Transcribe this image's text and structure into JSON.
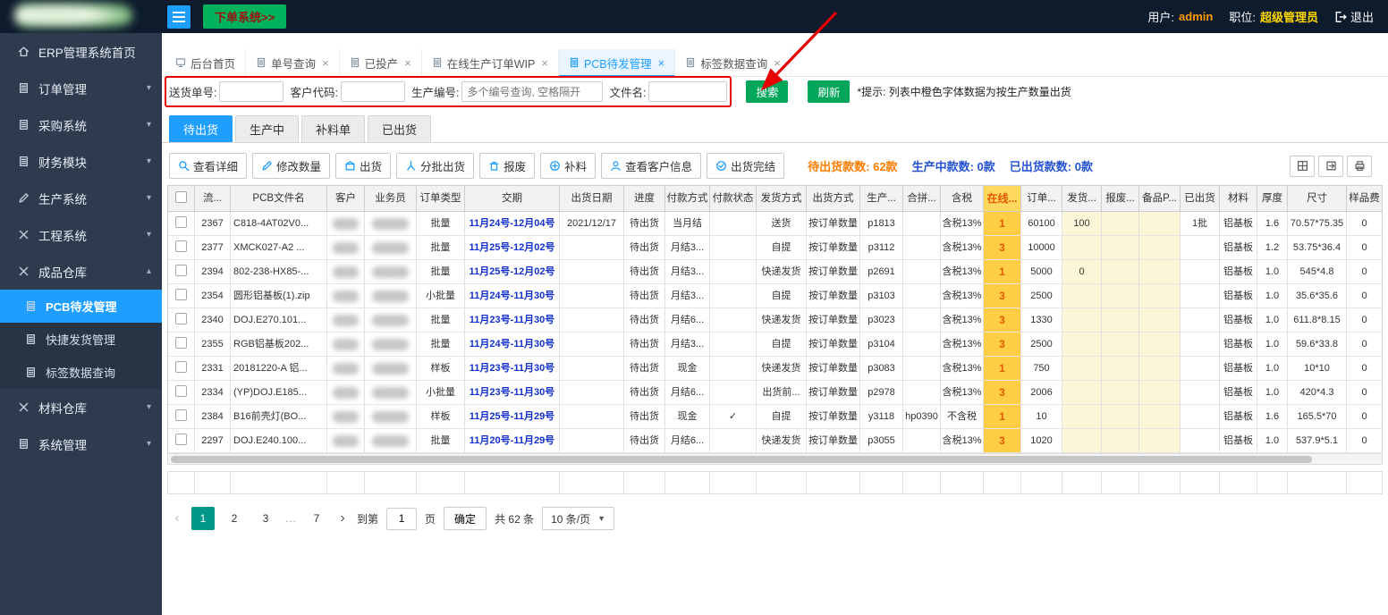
{
  "colors": {
    "accent_blue": "#1e9fff",
    "button_green": "#00a65a",
    "topbar_green": "#00b15c",
    "amber_cell": "#ffce45",
    "pale_yellow": "#fcf6d9",
    "annotation_red": "#e60000",
    "page_active_green": "#009688",
    "date_blue": "#1330cc"
  },
  "topbar": {
    "order_system_button": "下单系统>>",
    "user_label": "用户:",
    "user_value": "admin",
    "role_label": "职位:",
    "role_value": "超级管理员",
    "logout": "退出"
  },
  "sidebar": {
    "items": [
      {
        "label": "ERP管理系统首页",
        "icon": "home",
        "level": 1
      },
      {
        "label": "订单管理",
        "icon": "doc",
        "level": 1,
        "arrow": "down"
      },
      {
        "label": "采购系统",
        "icon": "doc",
        "level": 1,
        "arrow": "down"
      },
      {
        "label": "财务模块",
        "icon": "doc",
        "level": 1,
        "arrow": "down"
      },
      {
        "label": "生产系统",
        "icon": "pencil",
        "level": 1,
        "arrow": "down"
      },
      {
        "label": "工程系统",
        "icon": "tools",
        "level": 1,
        "arrow": "down"
      },
      {
        "label": "成品仓库",
        "icon": "tools",
        "level": 1,
        "arrow": "up"
      },
      {
        "label": "PCB待发管理",
        "icon": "doc",
        "level": 2,
        "active": true
      },
      {
        "label": "快捷发货管理",
        "icon": "doc",
        "level": 2
      },
      {
        "label": "标签数据查询",
        "icon": "doc",
        "level": 2
      },
      {
        "label": "材料仓库",
        "icon": "tools",
        "level": 1,
        "arrow": "down"
      },
      {
        "label": "系统管理",
        "icon": "doc",
        "level": 1,
        "arrow": "down"
      }
    ]
  },
  "tabs": [
    {
      "label": "后台首页",
      "icon": "monitor",
      "closable": false
    },
    {
      "label": "单号查询",
      "icon": "doc",
      "closable": true
    },
    {
      "label": "已投产",
      "icon": "doc",
      "closable": true
    },
    {
      "label": "在线生产订单WIP",
      "icon": "doc",
      "closable": true
    },
    {
      "label": "PCB待发管理",
      "icon": "doc",
      "closable": true,
      "active": true
    },
    {
      "label": "标签数据查询",
      "icon": "doc",
      "closable": true
    }
  ],
  "search": {
    "fields": [
      {
        "label": "送货单号:",
        "placeholder": ""
      },
      {
        "label": "客户代码:",
        "placeholder": ""
      },
      {
        "label": "生产编号:",
        "placeholder": "多个编号查询, 空格隔开"
      },
      {
        "label": "文件名:",
        "placeholder": ""
      }
    ],
    "search_button": "搜索",
    "refresh_button": "刷新",
    "hint": "*提示: 列表中橙色字体数据为按生产数量出货"
  },
  "subtabs": [
    {
      "label": "待出货",
      "active": true
    },
    {
      "label": "生产中"
    },
    {
      "label": "补料单"
    },
    {
      "label": "已出货"
    }
  ],
  "toolbar": {
    "buttons": [
      {
        "label": "查看详细",
        "icon": "magnifier"
      },
      {
        "label": "修改数量",
        "icon": "pencil"
      },
      {
        "label": "出货",
        "icon": "box"
      },
      {
        "label": "分批出货",
        "icon": "split"
      },
      {
        "label": "报废",
        "icon": "trash"
      },
      {
        "label": "补料",
        "icon": "plus"
      },
      {
        "label": "查看客户信息",
        "icon": "person"
      },
      {
        "label": "出货完结",
        "icon": "check"
      }
    ],
    "stats": [
      {
        "label": "待出货款数:",
        "value": "62款",
        "color": "orange"
      },
      {
        "label": "生产中款数:",
        "value": "0款",
        "color": "blue"
      },
      {
        "label": "已出货款数:",
        "value": "0款",
        "color": "blue"
      }
    ],
    "right_icons": [
      {
        "name": "columns",
        "icon": "grid"
      },
      {
        "name": "export",
        "icon": "export"
      },
      {
        "name": "print",
        "icon": "printer"
      }
    ]
  },
  "table": {
    "columns": [
      "流...",
      "PCB文件名",
      "客户",
      "业务员",
      "订单类型",
      "交期",
      "出货日期",
      "进度",
      "付款方式",
      "付款状态",
      "发货方式",
      "出货方式",
      "生产...",
      "合拼...",
      "含税",
      "在线...",
      "订单...",
      "发货...",
      "报废...",
      "备品P...",
      "已出货",
      "材料",
      "厚度",
      "尺寸",
      "样品费"
    ],
    "rows": [
      [
        "2367",
        "C818-4AT02V0...",
        "",
        "",
        "批量",
        "11月24号-12月04号",
        "2021/12/17",
        "待出货",
        "当月结",
        "",
        "送货",
        "按订单数量",
        "p1813",
        "",
        "含税13%",
        "1",
        "60100",
        "100",
        "",
        "",
        "1批",
        "铝基板",
        "1.6",
        "70.57*75.35",
        "0"
      ],
      [
        "2377",
        "XMCK027-A2 ...",
        "",
        "",
        "批量",
        "11月25号-12月02号",
        "",
        "待出货",
        "月结3...",
        "",
        "自提",
        "按订单数量",
        "p3112",
        "",
        "含税13%",
        "3",
        "10000",
        "",
        "",
        "",
        "",
        "铝基板",
        "1.2",
        "53.75*36.4",
        "0"
      ],
      [
        "2394",
        "802-238-HX85-...",
        "",
        "",
        "批量",
        "11月25号-12月02号",
        "",
        "待出货",
        "月结3...",
        "",
        "快递发货",
        "按订单数量",
        "p2691",
        "",
        "含税13%",
        "1",
        "5000",
        "0",
        "",
        "",
        "",
        "铝基板",
        "1.0",
        "545*4.8",
        "0"
      ],
      [
        "2354",
        "圆形铝基板(1).zip",
        "",
        "",
        "小批量",
        "11月24号-11月30号",
        "",
        "待出货",
        "月结3...",
        "",
        "自提",
        "按订单数量",
        "p3103",
        "",
        "含税13%",
        "3",
        "2500",
        "",
        "",
        "",
        "",
        "铝基板",
        "1.0",
        "35.6*35.6",
        "0"
      ],
      [
        "2340",
        "DOJ.E270.101...",
        "",
        "",
        "批量",
        "11月23号-11月30号",
        "",
        "待出货",
        "月结6...",
        "",
        "快递发货",
        "按订单数量",
        "p3023",
        "",
        "含税13%",
        "3",
        "1330",
        "",
        "",
        "",
        "",
        "铝基板",
        "1.0",
        "611.8*8.15",
        "0"
      ],
      [
        "2355",
        "RGB铝基板202...",
        "",
        "",
        "批量",
        "11月24号-11月30号",
        "",
        "待出货",
        "月结3...",
        "",
        "自提",
        "按订单数量",
        "p3104",
        "",
        "含税13%",
        "3",
        "2500",
        "",
        "",
        "",
        "",
        "铝基板",
        "1.0",
        "59.6*33.8",
        "0"
      ],
      [
        "2331",
        "20181220-A 铝...",
        "",
        "",
        "样板",
        "11月23号-11月30号",
        "",
        "待出货",
        "现金",
        "",
        "快递发货",
        "按订单数量",
        "p3083",
        "",
        "含税13%",
        "1",
        "750",
        "",
        "",
        "",
        "",
        "铝基板",
        "1.0",
        "10*10",
        "0"
      ],
      [
        "2334",
        "(YP)DOJ.E185...",
        "",
        "",
        "小批量",
        "11月23号-11月30号",
        "",
        "待出货",
        "月结6...",
        "",
        "出货前...",
        "按订单数量",
        "p2978",
        "",
        "含税13%",
        "3",
        "2006",
        "",
        "",
        "",
        "",
        "铝基板",
        "1.0",
        "420*4.3",
        "0"
      ],
      [
        "2384",
        "B16前壳灯(BO...",
        "",
        "",
        "样板",
        "11月25号-11月29号",
        "",
        "待出货",
        "现金",
        "✓",
        "自提",
        "按订单数量",
        "y3118",
        "hp0390",
        "不含税",
        "1",
        "10",
        "",
        "",
        "",
        "",
        "铝基板",
        "1.6",
        "165.5*70",
        "0"
      ],
      [
        "2297",
        "DOJ.E240.100...",
        "",
        "",
        "批量",
        "11月20号-11月29号",
        "",
        "待出货",
        "月结6...",
        "",
        "快递发货",
        "按订单数量",
        "p3055",
        "",
        "含税13%",
        "3",
        "1020",
        "",
        "",
        "",
        "",
        "铝基板",
        "1.0",
        "537.9*5.1",
        "0"
      ]
    ]
  },
  "pagination": {
    "prev": "‹",
    "next": "›",
    "pages": [
      "1",
      "2",
      "3",
      "...",
      "7"
    ],
    "active_page": "1",
    "goto_label": "到第",
    "goto_value": "1",
    "goto_suffix": "页",
    "confirm": "确定",
    "total": "共 62 条",
    "page_size": "10 条/页"
  }
}
